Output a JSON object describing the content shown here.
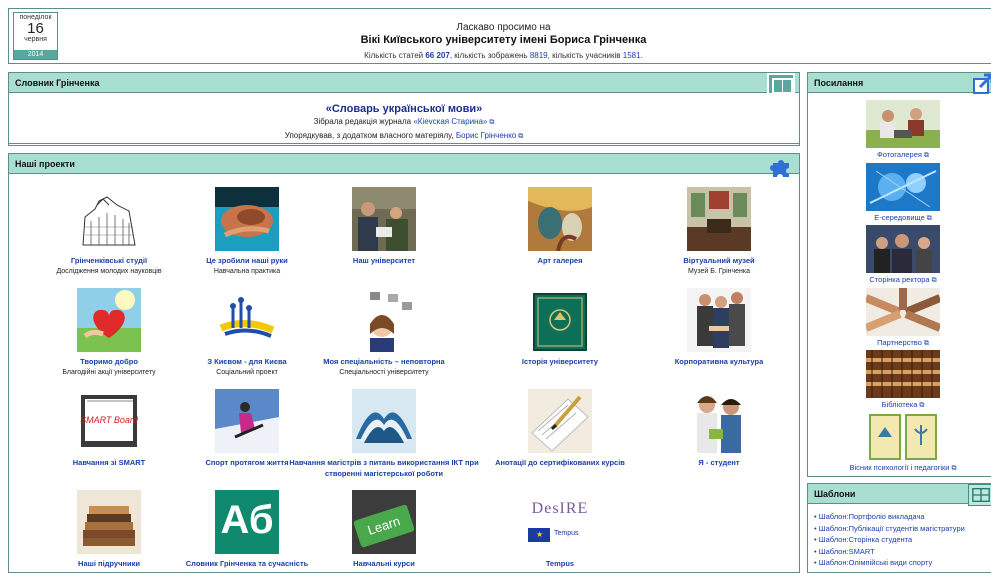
{
  "calendar": {
    "weekday": "понеділок",
    "day": "16",
    "month": "червня",
    "year": "2014"
  },
  "header": {
    "welcome": "Ласкаво просимо на",
    "title": "Вікі Київського університету імені Бориса Грінченка",
    "stats_prefix": "Кількість статей ",
    "articles": "66 207",
    "stats_mid1": ", кількість зображень ",
    "images": "8819",
    "stats_mid2": ", кількість учасників ",
    "members": "1581",
    "stats_end": "."
  },
  "dictionary": {
    "header": "Словник Грінченка",
    "title": "«Словарь української мови»",
    "line1_text": "Зібрала редакція журнала ",
    "line1_link": "«Кievская Старина»",
    "line2_text": "Упорядкував, з додатком власного матеріялу, ",
    "line2_link": "Борис Грінченко"
  },
  "projects": {
    "header": "Наші проекти",
    "items": [
      {
        "title": "Грінченківські студії",
        "desc": "Дослідження молодих науковців"
      },
      {
        "title": "Це зробили наші руки",
        "desc": "Навчальна практика"
      },
      {
        "title": "Наш університет",
        "desc": ""
      },
      {
        "title": "Арт галерея",
        "desc": ""
      },
      {
        "title": "Віртуальний музей",
        "desc": "Музей Б. Грінченка"
      },
      {
        "title": "Творимо добро",
        "desc": "Благодійні акції університету"
      },
      {
        "title": "З Києвом - для Києва",
        "desc": "Соціальний проект"
      },
      {
        "title": "Моя спеціальність – неповторна",
        "desc": "Спеціальності університету"
      },
      {
        "title": "Історія університету",
        "desc": ""
      },
      {
        "title": "Корпоративна культура",
        "desc": ""
      },
      {
        "title": "Навчання зі SMART",
        "desc": ""
      },
      {
        "title": "Спорт протягом життя",
        "desc": ""
      },
      {
        "title": "Навчання магістрів з питань використання ІКТ при створенні магістерської роботи",
        "desc": ""
      },
      {
        "title": "Анотації до сертифікованих курсів",
        "desc": ""
      },
      {
        "title": "Я - студент",
        "desc": ""
      },
      {
        "title": "Наші підручники",
        "desc": ""
      },
      {
        "title": "Словник Грінченка та сучасність",
        "desc": ""
      },
      {
        "title": "Навчальні курси",
        "desc": ""
      },
      {
        "title": "Tempus",
        "desc": ""
      }
    ],
    "smart_logo": "SMART Board",
    "ab_text": "Аб",
    "learn_text": "Learn",
    "desire_text": "DesIRE",
    "tempus_small": "Tempus"
  },
  "links": {
    "header": "Посилання",
    "items": [
      {
        "title": "Фотогалерея"
      },
      {
        "title": "Е-середовище"
      },
      {
        "title": "Сторінка ректора"
      },
      {
        "title": "Партнерство"
      },
      {
        "title": "Бібліотека"
      },
      {
        "title": "Вісник психології і педагогіки"
      }
    ]
  },
  "templates": {
    "header": "Шаблони",
    "items": [
      "Шаблон:Портфоліо викладача",
      "Шаблон:Публікації студентів магістратури",
      "Шаблон:Сторінка студента",
      "Шаблон:SMART",
      "Шаблон:Олімпійські види спорту"
    ]
  },
  "colors": {
    "header_bar": "#a8dfd1",
    "border": "#5d8e8a",
    "link": "#1a3ea8",
    "accent": "#5aa79f"
  }
}
